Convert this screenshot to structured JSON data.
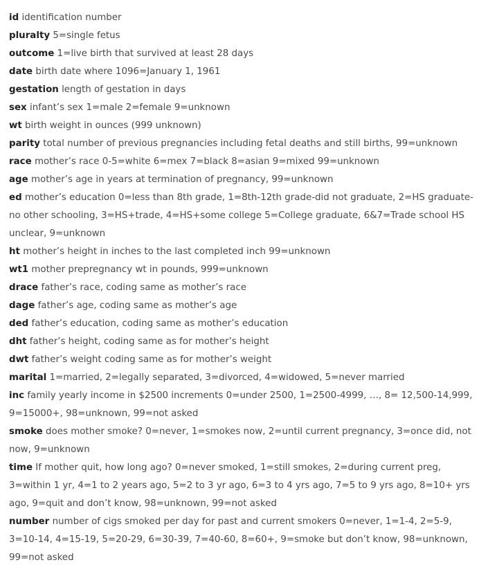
{
  "entries": [
    {
      "term": "id",
      "desc": "identification number"
    },
    {
      "term": "pluralty",
      "desc": "5=single fetus"
    },
    {
      "term": "outcome",
      "desc": "1=live birth that survived at least 28 days"
    },
    {
      "term": "date",
      "desc": "birth date where 1096=January 1, 1961"
    },
    {
      "term": "gestation",
      "desc": "length of gestation in days"
    },
    {
      "term": "sex",
      "desc": "infant’s sex 1=male 2=female 9=unknown"
    },
    {
      "term": "wt",
      "desc": "birth weight in ounces (999 unknown)"
    },
    {
      "term": "parity",
      "desc": "total number of previous pregnancies including fetal deaths and still births, 99=unknown"
    },
    {
      "term": "race",
      "desc": "mother’s race 0-5=white 6=mex 7=black 8=asian 9=mixed 99=unknown"
    },
    {
      "term": "age",
      "desc": "mother’s age in years at termination of pregnancy, 99=unknown"
    },
    {
      "term": "ed",
      "desc": "mother’s education 0=less than 8th grade, 1=8th-12th grade-did not graduate, 2=HS graduate-no other schooling, 3=HS+trade, 4=HS+some college 5=College graduate, 6&7=Trade school HS unclear, 9=unknown"
    },
    {
      "term": "ht",
      "desc": "mother’s height in inches to the last completed inch 99=unknown"
    },
    {
      "term": "wt1",
      "desc": "mother prepregnancy wt in pounds, 999=unknown"
    },
    {
      "term": "drace",
      "desc": "father’s race, coding same as mother’s race"
    },
    {
      "term": "dage",
      "desc": "father’s age, coding same as mother’s age"
    },
    {
      "term": "ded",
      "desc": "father’s education, coding same as mother’s education"
    },
    {
      "term": "dht",
      "desc": "father’s height, coding same as for mother’s height"
    },
    {
      "term": "dwt",
      "desc": "father’s weight coding same as for mother’s weight"
    },
    {
      "term": "marital",
      "desc": "1=married, 2=legally separated, 3=divorced, 4=widowed, 5=never married"
    },
    {
      "term": "inc",
      "desc": "family yearly income in $2500 increments 0=under 2500, 1=2500-4999, …, 8= 12,500-14,999, 9=15000+, 98=unknown, 99=not asked"
    },
    {
      "term": "smoke",
      "desc": "does mother smoke? 0=never, 1=smokes now, 2=until current pregnancy, 3=once did, not now, 9=unknown"
    },
    {
      "term": "time",
      "desc": "If mother quit, how long ago? 0=never smoked, 1=still smokes, 2=during current preg, 3=within 1 yr, 4=1 to 2 years ago, 5=2 to 3 yr ago, 6=3 to 4 yrs ago, 7=5 to 9 yrs ago, 8=10+ yrs ago, 9=quit and don’t know, 98=unknown, 99=not asked"
    },
    {
      "term": "number",
      "desc": "number of cigs smoked per day for past and current smokers 0=never, 1=1-4, 2=5-9, 3=10-14, 4=15-19, 5=20-29, 6=30-39, 7=40-60, 8=60+, 9=smoke but don’t know, 98=unknown, 99=not asked"
    }
  ]
}
